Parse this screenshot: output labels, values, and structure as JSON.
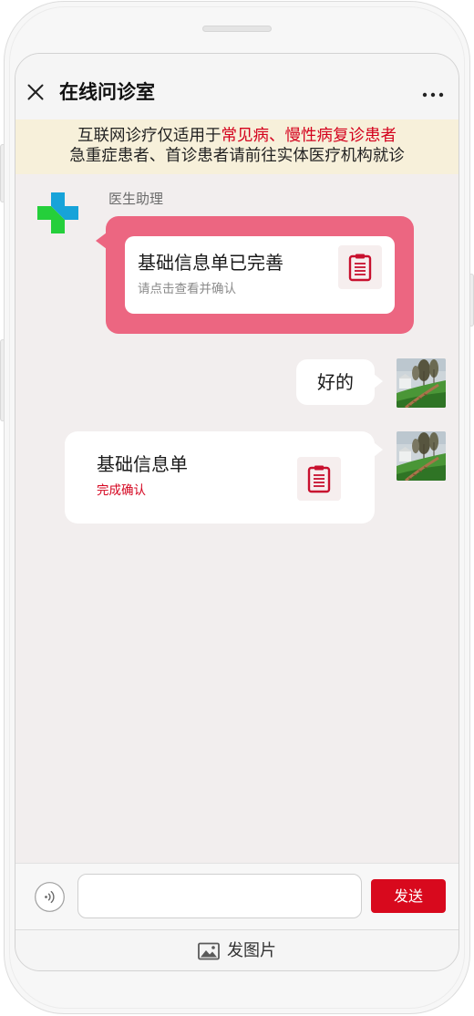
{
  "header": {
    "title": "在线问诊室",
    "close_icon": "close-icon",
    "more_icon": "more-options-icon"
  },
  "notice": {
    "line1_prefix": "互联网诊疗仅适用于",
    "line1_highlight": "常见病、慢性病复诊患者",
    "line2": "急重症患者、首诊患者请前往实体医疗机构就诊"
  },
  "chat": {
    "assistant_message": {
      "sender_name": "医生助理",
      "avatar_icon": "medical-cross-logo-icon",
      "card_title": "基础信息单已完善",
      "card_subtitle": "请点击查看并确认",
      "card_icon": "document-icon"
    },
    "user_reply": {
      "text": "好的",
      "avatar_icon": "user-avatar-photo-icon"
    },
    "user_card": {
      "card_title": "基础信息单",
      "card_status": "完成确认",
      "card_icon": "document-icon",
      "avatar_icon": "user-avatar-photo-icon"
    }
  },
  "composer": {
    "voice_icon": "voice-icon",
    "input_value": "",
    "input_placeholder": "",
    "send_label": "发送"
  },
  "bottom_bar": {
    "image_icon": "image-icon",
    "label": "发图片"
  },
  "theme": {
    "accent_red": "#d4021d",
    "bubble_pink": "#ec6681",
    "notice_background": "#f7f0da",
    "chat_background": "#f2eeee",
    "send_button": "#d8091d",
    "logo_green": "#25cf3b",
    "logo_blue": "#17a3d9"
  }
}
